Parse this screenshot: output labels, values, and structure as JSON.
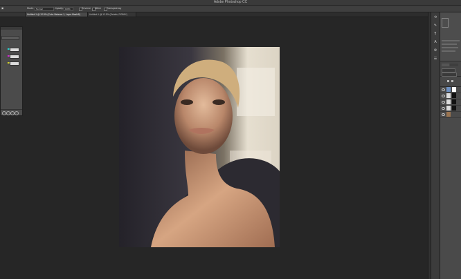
{
  "app": {
    "title": "Adobe Photoshop CC"
  },
  "options_bar": {
    "mode_label": "Mode:",
    "mode_value": "Normal",
    "opacity_label": "Opacity:",
    "opacity_value": "100%",
    "reverse_label": "Reverse",
    "dither_label": "Dither",
    "transparency_label": "Transparency"
  },
  "tabs": [
    {
      "label": "Untitled-1 @ 12.5% (Color Balance 1, Layer Mask/8)"
    },
    {
      "label": "Untitled-1 @ 12.5% (Details, RGB/8*)"
    }
  ],
  "icons": {
    "panel_tools": [
      "history-icon",
      "brush-icon",
      "paragraph-icon",
      "character-icon",
      "settings-icon",
      "properties-icon"
    ]
  },
  "canvas": {
    "colors": {
      "bg_dark": "#2b2a30",
      "bg_light": "#e7e0d2",
      "skin": "#c99a7b",
      "hair": "#cfae7d"
    }
  }
}
